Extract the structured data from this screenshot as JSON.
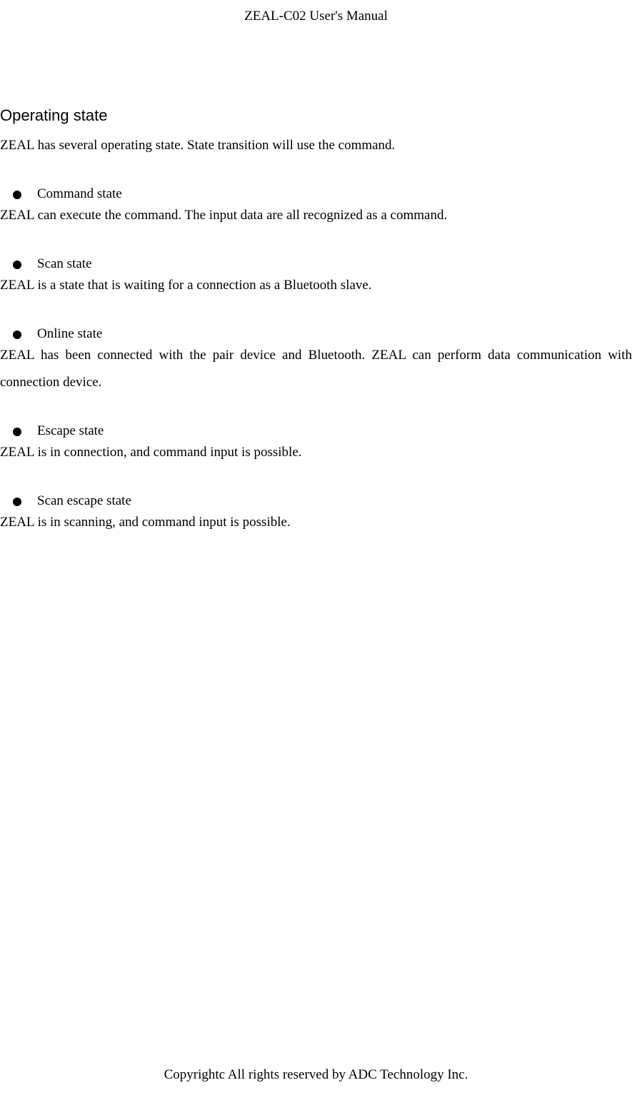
{
  "header": {
    "title": "ZEAL-C02 User's Manual"
  },
  "section": {
    "heading": "Operating state",
    "intro": "ZEAL has several operating state. State transition will use the command."
  },
  "items": [
    {
      "label": "Command state",
      "description": "ZEAL can execute the command. The input data are all recognized as a command."
    },
    {
      "label": "Scan state",
      "description": "ZEAL is a state that is waiting for a connection as a Bluetooth slave."
    },
    {
      "label": "Online state",
      "description": "ZEAL has been connected with the pair device and Bluetooth. ZEAL can perform data communication with connection device."
    },
    {
      "label": "Escape state",
      "description": "ZEAL is in connection, and command input is possible."
    },
    {
      "label": "Scan escape state",
      "description": "ZEAL is in scanning, and command input is possible."
    }
  ],
  "footer": {
    "copyright": "Copyrightc All rights reserved by ADC Technology Inc."
  }
}
